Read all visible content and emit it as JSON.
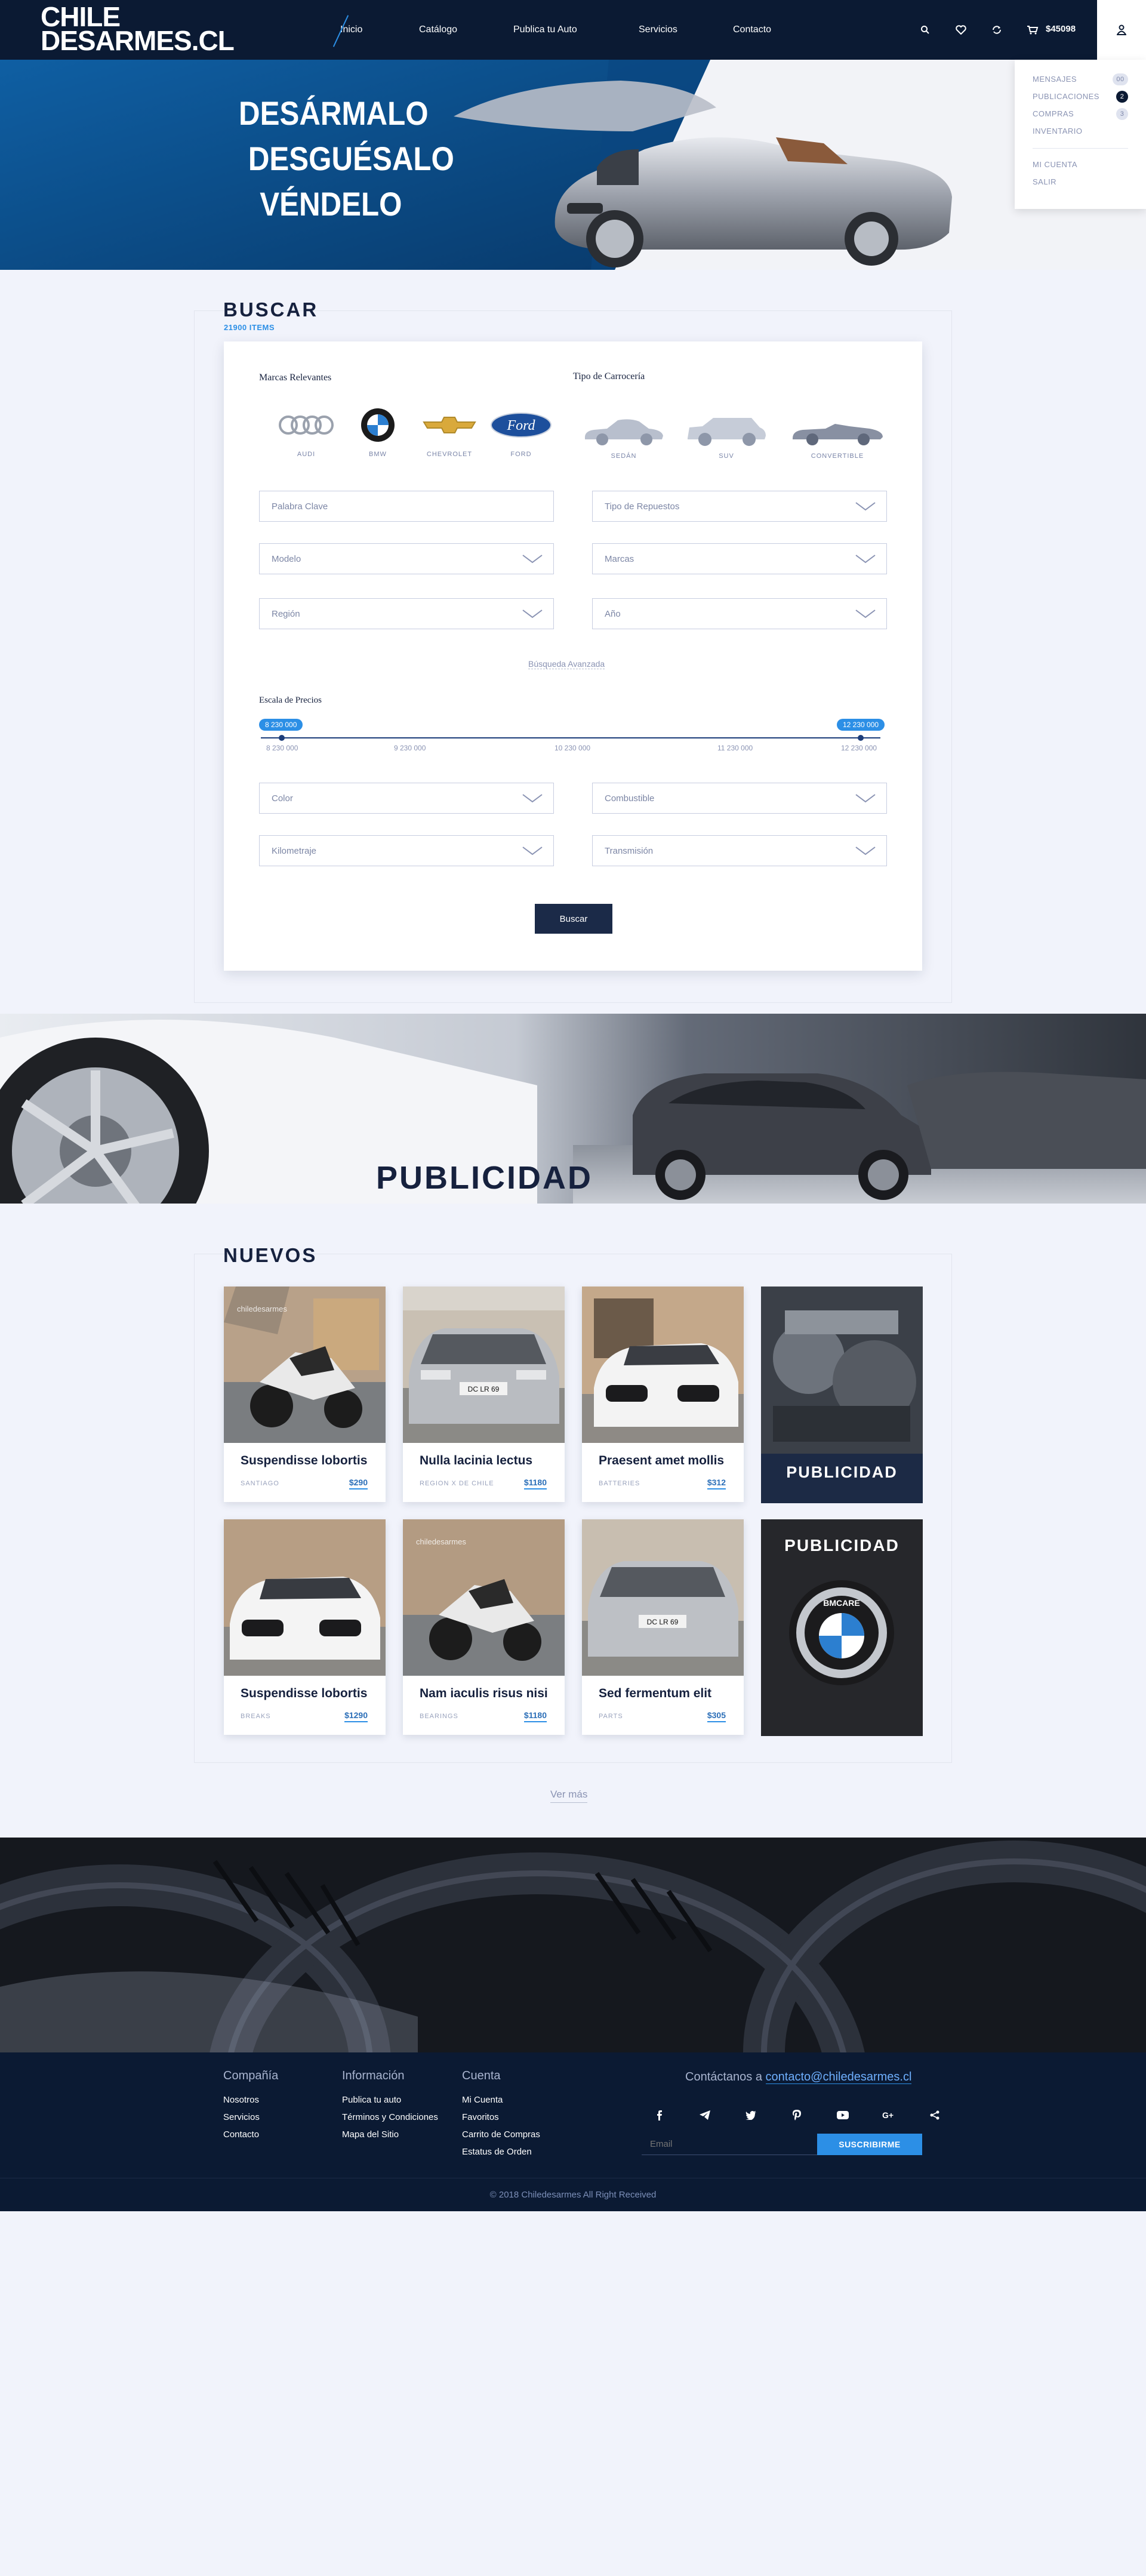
{
  "header": {
    "logo_line1": "CHILE",
    "logo_line2": "DESARMES.CL",
    "nav": [
      "Inicio",
      "Catálogo",
      "Publica tu Auto",
      "Servicios",
      "Contacto"
    ],
    "cart_total": "$45098",
    "icons": [
      "search-icon",
      "heart-icon",
      "refresh-icon",
      "cart-icon",
      "user-icon"
    ]
  },
  "user_menu": {
    "items": [
      {
        "label": "MENSAJES",
        "badge": "00"
      },
      {
        "label": "PUBLICACIONES",
        "badge": "2"
      },
      {
        "label": "COMPRAS",
        "badge": "3"
      },
      {
        "label": "INVENTARIO",
        "badge": ""
      }
    ],
    "account": [
      "MI CUENTA",
      "SALIR"
    ]
  },
  "hero": {
    "lines": [
      "DESÁRMALO",
      "DESGUÉSALO",
      "VÉNDELO"
    ]
  },
  "search": {
    "title": "BUSCAR",
    "count": "21900 ITEMS",
    "brands_label": "Marcas Relevantes",
    "brands": [
      "AUDI",
      "BMW",
      "CHEVROLET",
      "FORD"
    ],
    "body_label": "Tipo de Carrocería",
    "body_types": [
      "SEDÁN",
      "SUV",
      "CONVERTIBLE"
    ],
    "fields": {
      "keyword": "Palabra Clave",
      "parts_type": "Tipo de Repuestos",
      "model": "Modelo",
      "brands": "Marcas",
      "region": "Región",
      "year": "Año",
      "color": "Color",
      "fuel": "Combustible",
      "mileage": "Kilometraje",
      "transmission": "Transmisión"
    },
    "advanced": "Búsqueda Avanzada",
    "price_label": "Escala de Precios",
    "price_min": "8 230 000",
    "price_max": "12 230 000",
    "ticks": [
      "8 230 000",
      "9 230 000",
      "10 230 000",
      "11 230 000",
      "12 230 000"
    ],
    "button": "Buscar"
  },
  "banner": {
    "text": "PUBLICIDAD"
  },
  "nuevos": {
    "title": "NUEVOS",
    "products": [
      {
        "title": "Suspendisse lobortis",
        "category": "SANTIAGO",
        "price": "$290"
      },
      {
        "title": "Nulla lacinia lectus",
        "category": "REGION X DE CHILE",
        "price": "$1180"
      },
      {
        "title": "Praesent amet mollis",
        "category": "BATTERIES",
        "price": "$312"
      },
      {
        "title": "Suspendisse lobortis",
        "category": "BREAKS",
        "price": "$1290"
      },
      {
        "title": "Nam iaculis risus nisi",
        "category": "BEARINGS",
        "price": "$1180"
      },
      {
        "title": "Sed fermentum elit",
        "category": "PARTS",
        "price": "$305"
      }
    ],
    "ads": [
      "PUBLICIDAD",
      "PUBLICIDAD"
    ],
    "ad_badge": "BMCARE",
    "watermark": "chiledesarmes",
    "plate": "DC LR 69",
    "more": "Ver más"
  },
  "footer": {
    "columns": [
      {
        "title": "Compañía",
        "links": [
          "Nosotros",
          "Servicios",
          "Contacto"
        ]
      },
      {
        "title": "Información",
        "links": [
          "Publica tu auto",
          "Términos y Condiciones",
          "Mapa del Sitio"
        ]
      },
      {
        "title": "Cuenta",
        "links": [
          "Mi Cuenta",
          "Favoritos",
          "Carrito de Compras",
          "Estatus de Orden"
        ]
      }
    ],
    "contact_prefix": "Contáctanos a",
    "contact_email": "contacto@chiledesarmes.cl",
    "social": [
      "facebook-icon",
      "telegram-icon",
      "twitter-icon",
      "pinterest-icon",
      "youtube-icon",
      "google-plus-icon",
      "share-icon"
    ],
    "email_placeholder": "Email",
    "subscribe": "SUSCRIBIRME",
    "copyright": "© 2018 Chiledesarmes All Right Received"
  },
  "colors": {
    "navy": "#0b1a33",
    "accent": "#2c8fe6",
    "hero_blue": "#0d5796",
    "background": "#f1f3fb"
  }
}
